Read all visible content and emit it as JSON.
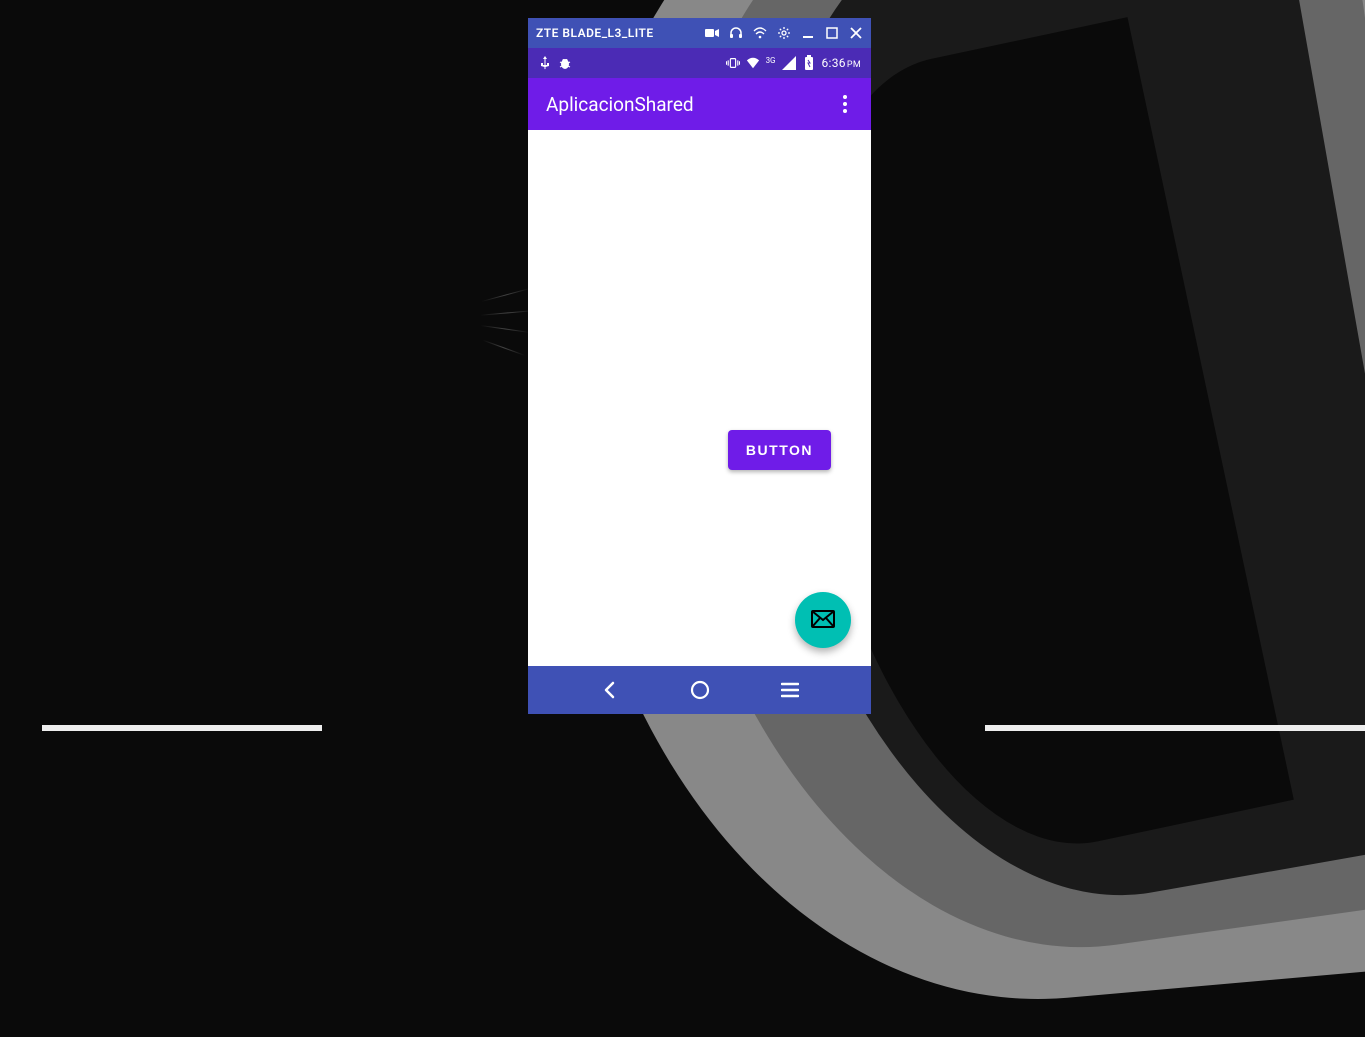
{
  "emulator": {
    "device_name": "ZTE BLADE_L3_LITE"
  },
  "status_bar": {
    "network_type": "3G",
    "time": "6:36",
    "time_period": "PM"
  },
  "app_bar": {
    "title": "AplicacionShared"
  },
  "content": {
    "button_label": "BUTTON"
  },
  "colors": {
    "emulator_chrome": "#3f51b5",
    "status_bar": "#4b2bb5",
    "app_bar": "#6f1ce8",
    "button": "#6f1ce8",
    "fab": "#00bfb3"
  }
}
